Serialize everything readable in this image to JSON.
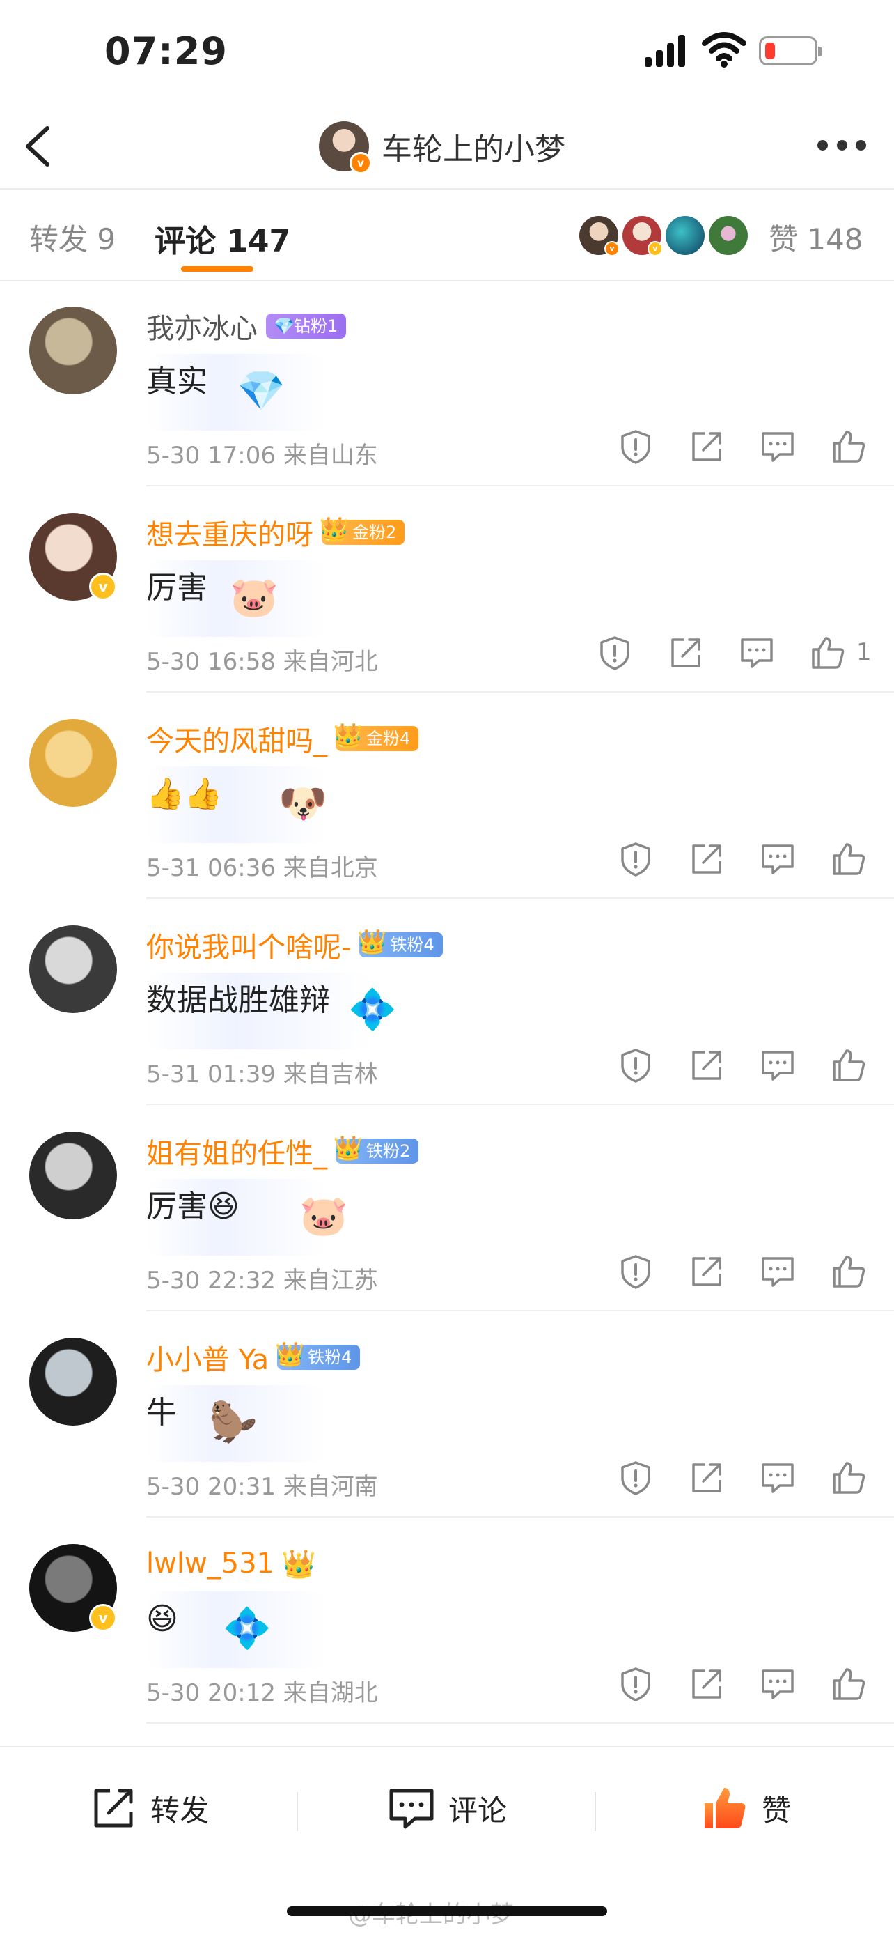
{
  "status_bar": {
    "time": "07:29"
  },
  "header": {
    "title": "车轮上的小梦",
    "back_icon": "chevron-left-icon",
    "more_icon": "more-dots-icon"
  },
  "tabs": {
    "repost": "转发 9",
    "comments": "评论 147",
    "likes": "赞 148"
  },
  "comments": [
    {
      "name": "我亦冰心",
      "name_color": "gray",
      "badge": "钻粉1",
      "badge_type": "diamond",
      "text": "真实",
      "sticker": "💎",
      "time": "5-30 17:06",
      "location": "来自山东",
      "likes": "",
      "verified": false,
      "avatar_colors": [
        "#c8b89a",
        "#6b5b48"
      ]
    },
    {
      "name": "想去重庆的呀",
      "name_color": "orange",
      "badge": "金粉2",
      "badge_type": "gold",
      "crown": "👑",
      "text": "厉害",
      "sticker": "🐷",
      "time": "5-30 16:58",
      "location": "来自河北",
      "likes": "1",
      "verified": true,
      "avatar_colors": [
        "#f2dccd",
        "#5a3a2e"
      ]
    },
    {
      "name": "今天的风甜吗_",
      "name_color": "orange",
      "badge": "金粉4",
      "badge_type": "gold",
      "crown": "👑",
      "text": "👍👍",
      "sticker": "🐶",
      "time": "5-31 06:36",
      "location": "来自北京",
      "likes": "",
      "verified": false,
      "avatar_colors": [
        "#f6d58c",
        "#e2a93c"
      ]
    },
    {
      "name": "你说我叫个啥呢-",
      "name_color": "orange",
      "badge": "铁粉4",
      "badge_type": "iron",
      "crown": "👑",
      "text": "数据战胜雄辩",
      "sticker": "💠",
      "time": "5-31 01:39",
      "location": "来自吉林",
      "likes": "",
      "verified": false,
      "avatar_colors": [
        "#d9d9d9",
        "#3a3a3a"
      ]
    },
    {
      "name": "姐有姐的任性_",
      "name_color": "orange",
      "badge": "铁粉2",
      "badge_type": "iron",
      "crown": "👑",
      "text": "厉害😆",
      "sticker": "🐷",
      "time": "5-30 22:32",
      "location": "来自江苏",
      "likes": "",
      "verified": false,
      "avatar_colors": [
        "#cfcfcf",
        "#2a2a2a"
      ]
    },
    {
      "name": "小小普 Ya",
      "name_color": "orange",
      "badge": "铁粉4",
      "badge_type": "iron",
      "crown": "👑",
      "text": "牛",
      "sticker": "🦫",
      "time": "5-30 20:31",
      "location": "来自河南",
      "likes": "",
      "verified": false,
      "avatar_colors": [
        "#bfc7cf",
        "#1e1e1e"
      ]
    },
    {
      "name": "lwlw_531",
      "name_color": "orange",
      "badge": "",
      "badge_type": "crown-only",
      "crown": "👑",
      "text": "😆",
      "sticker": "💠",
      "time": "5-30 20:12",
      "location": "来自湖北",
      "likes": "",
      "verified": true,
      "avatar_colors": [
        "#7a7a7a",
        "#141414"
      ]
    }
  ],
  "bottom_bar": {
    "repost": "转发",
    "comment": "评论",
    "like": "赞"
  },
  "watermark": "@车轮上的小梦",
  "colors": {
    "accent": "#ff8200",
    "like_active": "#ff6a00"
  }
}
